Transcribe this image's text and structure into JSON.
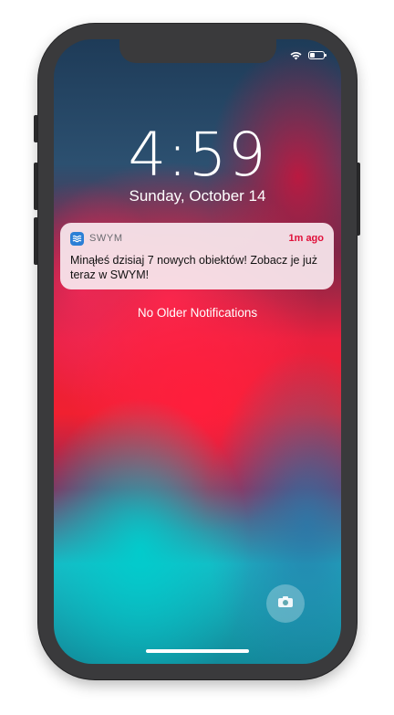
{
  "status_bar": {
    "wifi_icon": "wifi-icon",
    "battery_icon": "battery-icon"
  },
  "lock_screen": {
    "time": "4:59",
    "date": "Sunday, October 14",
    "no_older_label": "No Older Notifications",
    "camera_icon": "camera-icon"
  },
  "notification": {
    "app_name": "SWYM",
    "app_icon": "swym-app-icon",
    "time_ago": "1m ago",
    "message": "Minąłeś dzisiaj 7 nowych obiektów! Zobacz je już teraz w SWYM!"
  },
  "colors": {
    "device_frame": "#3a3a3c",
    "notification_bg": "#f8e8ee",
    "time_accent": "#e0103a",
    "app_icon_bg": "#2b7fd6"
  }
}
